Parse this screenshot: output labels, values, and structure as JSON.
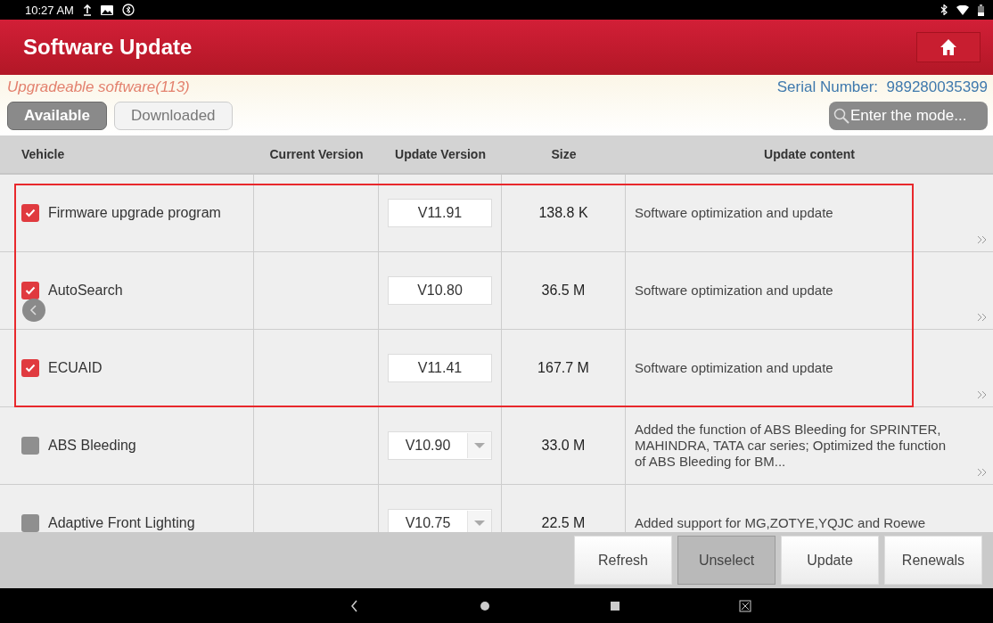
{
  "status_bar": {
    "time": "10:27 AM"
  },
  "header": {
    "title": "Software Update"
  },
  "info": {
    "count_label": "Upgradeable software(113)",
    "serial": "Serial Number:  989280035399"
  },
  "tabs": [
    {
      "label": "Available",
      "selected": true
    },
    {
      "label": "Downloaded",
      "selected": false
    }
  ],
  "search": {
    "placeholder": "Enter the mode..."
  },
  "table": {
    "columns": [
      "Vehicle",
      "Current Version",
      "Update Version",
      "Size",
      "Update content"
    ],
    "rows": [
      {
        "vehicle": "Firmware upgrade program",
        "checked": true,
        "update": "V11.91",
        "dropdown": false,
        "size": "138.8 K",
        "content": "Software optimization and update",
        "highlighted": true
      },
      {
        "vehicle": "AutoSearch",
        "checked": true,
        "update": "V10.80",
        "dropdown": false,
        "size": "36.5 M",
        "content": "Software optimization and update",
        "highlighted": true
      },
      {
        "vehicle": "ECUAID",
        "checked": true,
        "update": "V11.41",
        "dropdown": false,
        "size": "167.7 M",
        "content": "Software optimization and update",
        "highlighted": true
      },
      {
        "vehicle": "ABS Bleeding",
        "checked": false,
        "update": "V10.90",
        "dropdown": true,
        "size": "33.0 M",
        "content": "Added the function of ABS Bleeding for SPRINTER, MAHINDRA, TATA car series; Optimized the function of ABS Bleeding for BM...",
        "highlighted": false
      },
      {
        "vehicle": "Adaptive Front Lighting",
        "checked": false,
        "update": "V10.75",
        "dropdown": true,
        "size": "22.5 M",
        "content": "Added support for MG,ZOTYE,YQJC and Roewe",
        "highlighted": false
      }
    ]
  },
  "actions": [
    {
      "label": "Refresh",
      "selected": false
    },
    {
      "label": "Unselect",
      "selected": true
    },
    {
      "label": "Update",
      "selected": false
    },
    {
      "label": "Renewals",
      "selected": false
    }
  ]
}
